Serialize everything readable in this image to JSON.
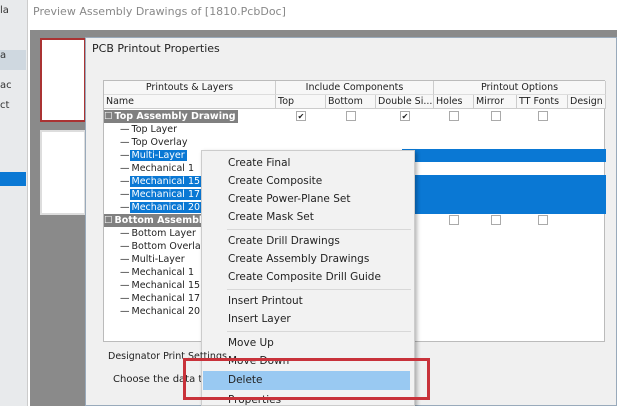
{
  "background": {
    "title": "Preview Assembly Drawings of [1810.PcbDoc]",
    "left_fragments": [
      "la",
      "a",
      "ac",
      "ct"
    ]
  },
  "dialog": {
    "title": "PCB Printout Properties",
    "groups": [
      "Printouts & Layers",
      "Include Components",
      "Printout Options"
    ],
    "columns": [
      "Name",
      "Top",
      "Bottom",
      "Double Si...",
      "Holes",
      "Mirror",
      "TT Fonts",
      "Design"
    ],
    "rows": [
      {
        "name": "Top Assembly Drawing",
        "type": "group",
        "checks": [
          true,
          false,
          true,
          false,
          false,
          false
        ]
      },
      {
        "name": "Top Layer"
      },
      {
        "name": "Top Overlay"
      },
      {
        "name": "Multi-Layer",
        "selected": true
      },
      {
        "name": "Mechanical 1"
      },
      {
        "name": "Mechanical 15",
        "selected": true
      },
      {
        "name": "Mechanical 17",
        "selected": true
      },
      {
        "name": "Mechanical 20",
        "selected": true
      },
      {
        "name": "Bottom Assembly Drawing",
        "type": "group",
        "checks": [
          false,
          false,
          false,
          false,
          false,
          false
        ]
      },
      {
        "name": "Bottom Layer"
      },
      {
        "name": "Bottom Overlay"
      },
      {
        "name": "Multi-Layer"
      },
      {
        "name": "Mechanical 1"
      },
      {
        "name": "Mechanical 15"
      },
      {
        "name": "Mechanical 17"
      },
      {
        "name": "Mechanical 20"
      }
    ],
    "designator_group": "Designator Print Settings",
    "designator_text": "Choose the data to print"
  },
  "context_menu": {
    "items": [
      "Create Final",
      "Create Composite",
      "Create Power-Plane Set",
      "Create Mask Set",
      "Create Drill Drawings",
      "Create Assembly Drawings",
      "Create Composite Drill Guide",
      "Insert Printout",
      "Insert Layer",
      "Move Up",
      "Move Down",
      "Delete",
      "Properties"
    ],
    "highlighted": "Delete"
  },
  "colors": {
    "selection": "#0a78d4",
    "highlight": "#99c9f2",
    "annotation": "#c8323a"
  }
}
